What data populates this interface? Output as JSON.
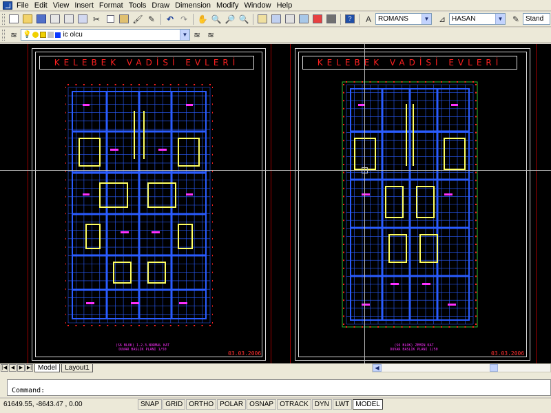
{
  "menu": [
    "File",
    "Edit",
    "View",
    "Insert",
    "Format",
    "Tools",
    "Draw",
    "Dimension",
    "Modify",
    "Window",
    "Help"
  ],
  "toolbar": {
    "text_style": "ROMANS",
    "dim_style": "HASAN",
    "table_style": "Stand"
  },
  "layers": {
    "current_layer": "ic olcu"
  },
  "drawing": {
    "sheet_left": {
      "title": "KELEBEK VADİSİ EVLERİ",
      "date": "03.03.2006",
      "caption_line1": "(S6 BLOK) 1.2.3.NORMAL KAT",
      "caption_line2": "DUVAR BASLIK PLANI 1/50"
    },
    "sheet_right": {
      "title": "KELEBEK VADİSİ EVLERİ",
      "date": "03.03.2006",
      "caption_line1": "(S6 BLOK) ZEMIN KAT",
      "caption_line2": "DUVAR BASLIK PLANI 1/50"
    }
  },
  "tabs": {
    "model": "Model",
    "layout1": "Layout1"
  },
  "command": {
    "prompt": "Command:"
  },
  "status": {
    "coordinates": "61649.55, -8643.47 , 0.00",
    "buttons": [
      "SNAP",
      "GRID",
      "ORTHO",
      "POLAR",
      "OSNAP",
      "OTRACK",
      "DYN",
      "LWT",
      "MODEL"
    ]
  },
  "colors": {
    "title": "#ff2020",
    "plan_blue": "#2a5cff",
    "plan_magenta": "#ff30ff",
    "plan_yellow": "#ffff60",
    "plan_red": "#ff2020",
    "background": "#000000"
  }
}
